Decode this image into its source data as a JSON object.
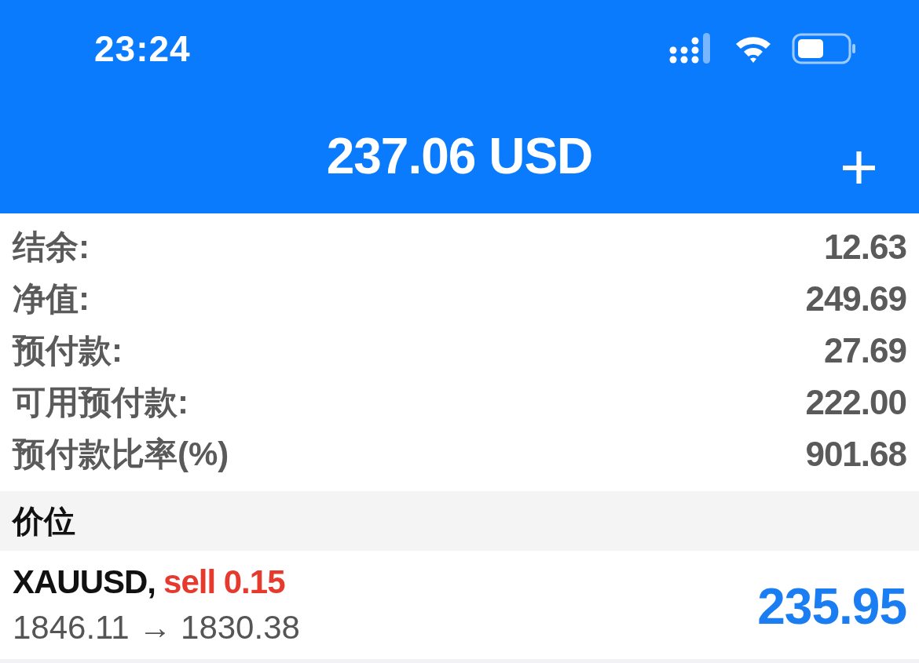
{
  "status_bar": {
    "time": "23:24"
  },
  "header": {
    "title": "237.06 USD",
    "action": "+"
  },
  "summary": [
    {
      "label": "结余:",
      "value": "12.63"
    },
    {
      "label": "净值:",
      "value": "249.69"
    },
    {
      "label": "预付款:",
      "value": "27.69"
    },
    {
      "label": "可用预付款:",
      "value": "222.00"
    },
    {
      "label": "预付款比率(%)",
      "value": "901.68"
    }
  ],
  "section": {
    "title": "价位"
  },
  "positions": [
    {
      "symbol": "XAUUSD,",
      "order": "sell 0.15",
      "prices": "1846.11 → 1830.38",
      "profit": "235.95"
    }
  ]
}
